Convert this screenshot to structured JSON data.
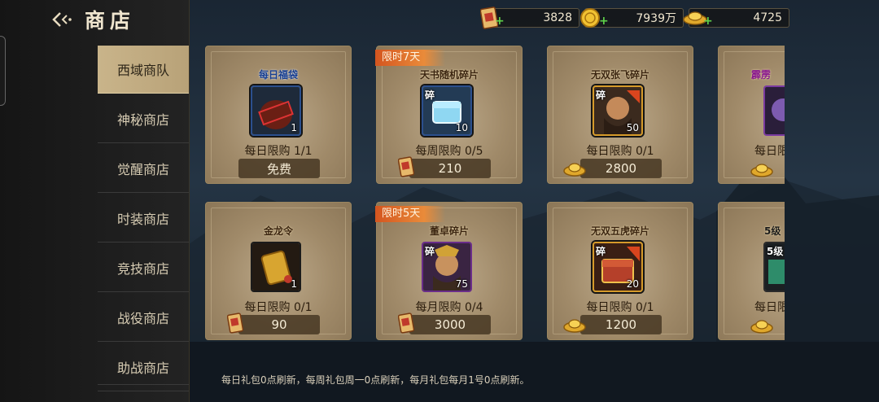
{
  "header": {
    "title": "商店"
  },
  "sidebar": {
    "items": [
      {
        "label": "西域商队",
        "active": true
      },
      {
        "label": "神秘商店"
      },
      {
        "label": "觉醒商店"
      },
      {
        "label": "时装商店"
      },
      {
        "label": "竞技商店"
      },
      {
        "label": "战役商店"
      },
      {
        "label": "助战商店"
      }
    ]
  },
  "currencies": [
    {
      "icon": "ticket-icon",
      "value": "3828"
    },
    {
      "icon": "gold-coin-icon",
      "value": "7939万"
    },
    {
      "icon": "gold-ingot-icon",
      "value": "4725"
    }
  ],
  "cards": [
    {
      "ribbon": "",
      "name": "每日福袋",
      "qty": "1",
      "limit": "每日限购 1/1",
      "price": "免费",
      "price_icon": "",
      "icon": "lucky-bag-icon"
    },
    {
      "ribbon": "限时7天",
      "name": "天书随机碎片",
      "qty": "10",
      "frag": "碎",
      "limit": "每周限购 0/5",
      "price": "210",
      "price_icon": "ticket-icon",
      "icon": "book-chest-icon"
    },
    {
      "ribbon": "",
      "name": "无双张飞碎片",
      "qty": "50",
      "frag": "碎",
      "limit": "每日限购 0/1",
      "price": "2800",
      "price_icon": "gold-ingot-icon",
      "icon": "hero-portrait-icon"
    },
    {
      "ribbon": "",
      "name": "霹雳",
      "qty": "",
      "frag": "",
      "limit": "每日限",
      "price": "",
      "price_icon": "gold-ingot-icon",
      "icon": "partial-item-icon"
    },
    {
      "ribbon": "",
      "name": "金龙令",
      "qty": "1",
      "limit": "每日限购 0/1",
      "price": "90",
      "price_icon": "ticket-icon",
      "icon": "dragon-token-icon"
    },
    {
      "ribbon": "限时5天",
      "name": "董卓碎片",
      "qty": "75",
      "frag": "碎",
      "limit": "每月限购 0/4",
      "price": "3000",
      "price_icon": "ticket-icon",
      "icon": "hero-portrait-icon"
    },
    {
      "ribbon": "",
      "name": "无双五虎碎片",
      "qty": "20",
      "frag": "碎",
      "limit": "每日限购 0/1",
      "price": "1200",
      "price_icon": "gold-ingot-icon",
      "icon": "treasure-chest-icon"
    },
    {
      "ribbon": "",
      "name": "5级",
      "qty": "",
      "frag": "5级",
      "limit": "每日限",
      "price": "",
      "price_icon": "gold-ingot-icon",
      "icon": "partial-item-icon"
    }
  ],
  "footer": {
    "note": "每日礼包0点刷新，每周礼包周一0点刷新，每月礼包每月1号0点刷新。"
  }
}
